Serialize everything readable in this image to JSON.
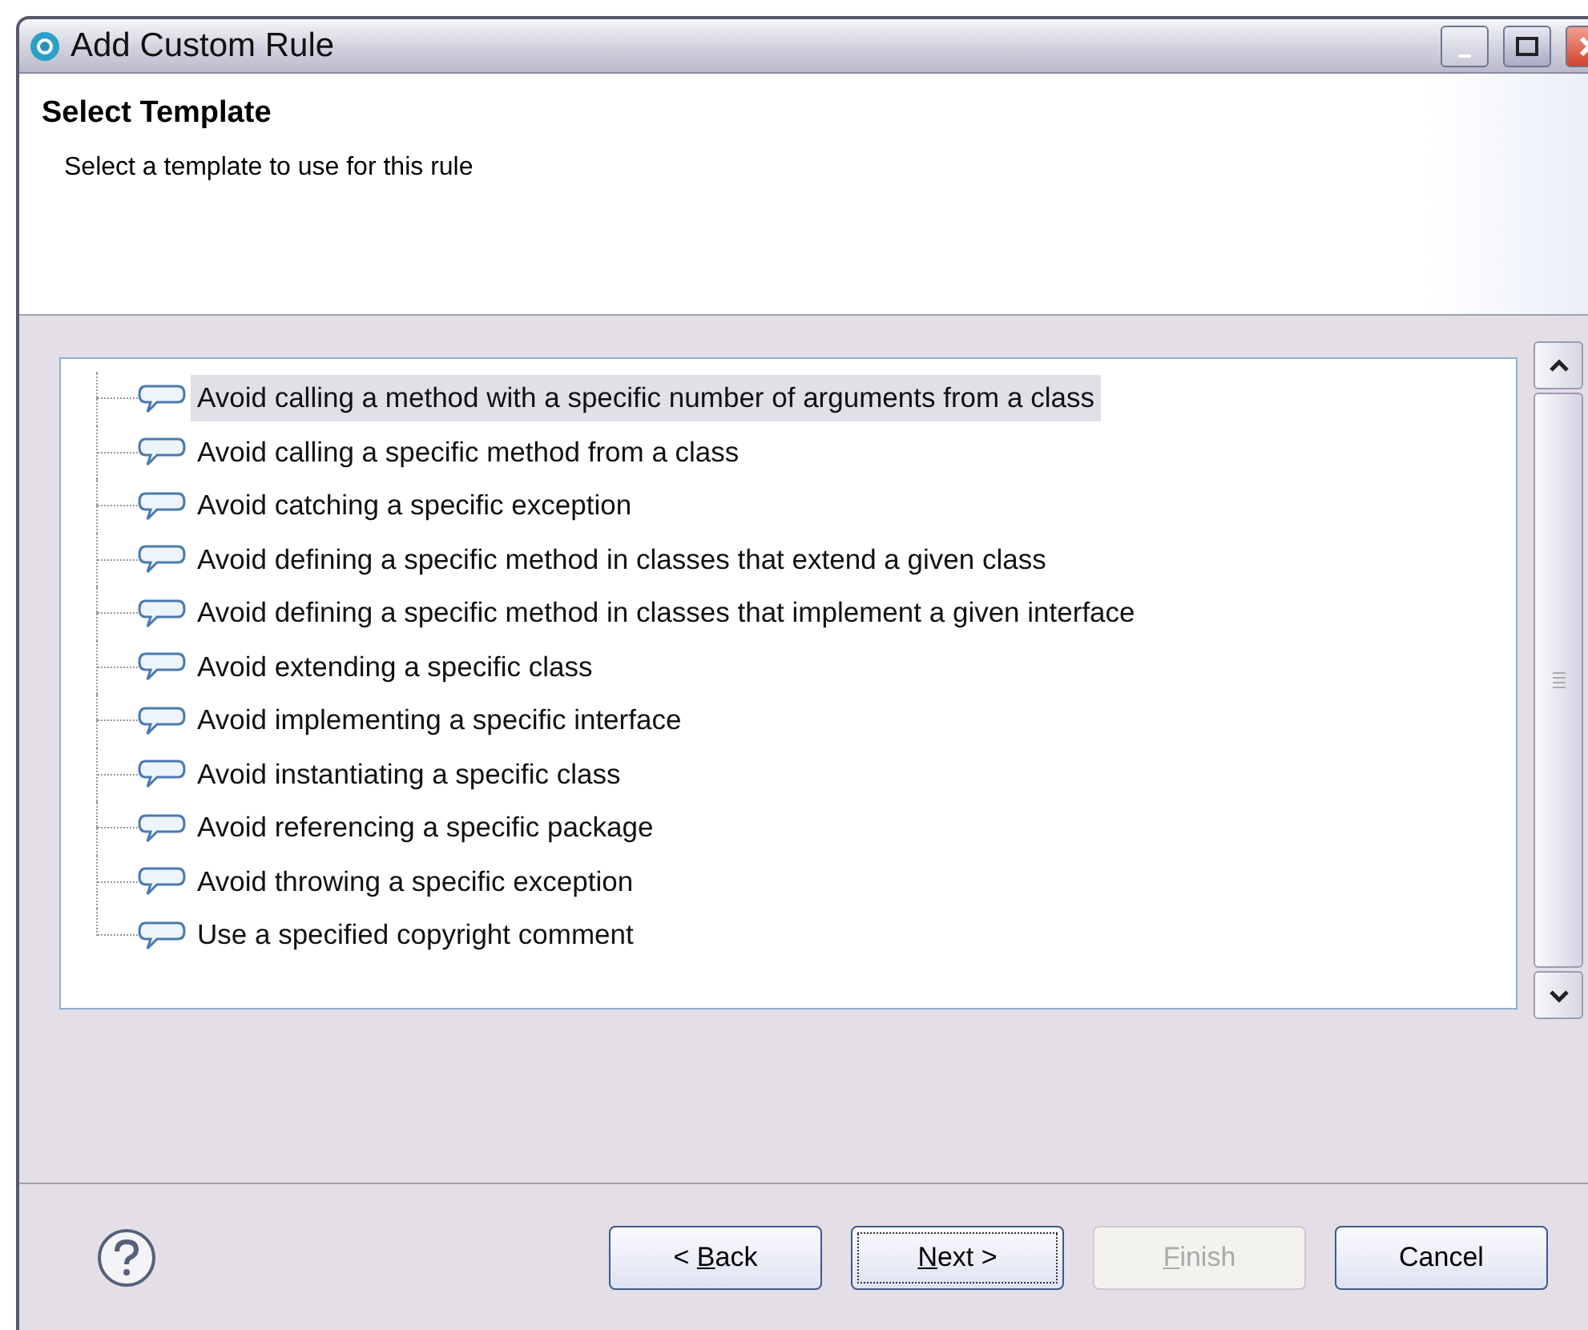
{
  "window": {
    "title": "Add Custom Rule"
  },
  "header": {
    "title": "Select Template",
    "description": "Select a template to use for this rule"
  },
  "templates": [
    {
      "label": "Avoid calling a method with a specific number of arguments from a class",
      "selected": true
    },
    {
      "label": "Avoid calling a specific method from a class",
      "selected": false
    },
    {
      "label": "Avoid catching a specific exception",
      "selected": false
    },
    {
      "label": "Avoid defining a specific method in classes that extend a given class",
      "selected": false
    },
    {
      "label": "Avoid defining a specific method in classes that implement a given interface",
      "selected": false
    },
    {
      "label": "Avoid extending a specific class",
      "selected": false
    },
    {
      "label": "Avoid implementing a specific interface",
      "selected": false
    },
    {
      "label": "Avoid instantiating a specific class",
      "selected": false
    },
    {
      "label": "Avoid referencing a specific package",
      "selected": false
    },
    {
      "label": "Avoid throwing a specific exception",
      "selected": false
    },
    {
      "label": "Use a specified copyright comment",
      "selected": false
    }
  ],
  "buttons": [
    {
      "label": {
        "before": "< ",
        "mnemonic": "B",
        "after": "ack"
      },
      "disabled": false,
      "default": false
    },
    {
      "label": {
        "mnemonic": "N",
        "after": "ext >"
      },
      "disabled": false,
      "default": true
    },
    {
      "label": {
        "mnemonic": "F",
        "after": "inish"
      },
      "disabled": true,
      "default": false
    },
    {
      "label": {
        "before": "Cancel"
      },
      "disabled": false,
      "default": false
    }
  ]
}
